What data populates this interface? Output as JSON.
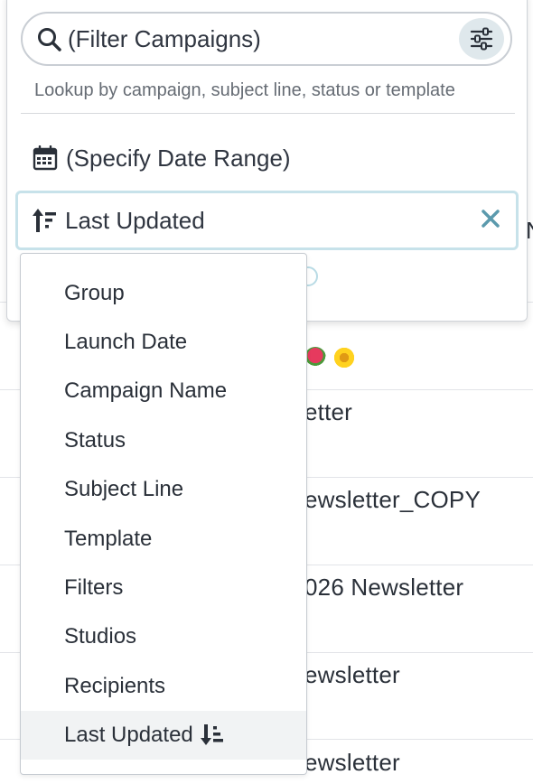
{
  "filter": {
    "search_placeholder": "(Filter Campaigns)",
    "hint": "Lookup by campaign, subject line, status or template",
    "date_range_label": "(Specify Date Range)",
    "sort_label": "Last Updated"
  },
  "sort_menu": {
    "items": [
      {
        "label": "Group"
      },
      {
        "label": "Launch Date"
      },
      {
        "label": "Campaign Name"
      },
      {
        "label": "Status"
      },
      {
        "label": "Subject Line"
      },
      {
        "label": "Template"
      },
      {
        "label": "Filters"
      },
      {
        "label": "Studios"
      },
      {
        "label": "Recipients"
      },
      {
        "label": "Last Updated",
        "active": true,
        "icon": "sort-descending-icon"
      }
    ]
  },
  "background_rows": [
    {
      "text": "etter"
    },
    {
      "text": "ewsletter_COPY"
    },
    {
      "text": "026 Newsletter"
    },
    {
      "text": "ewsletter"
    },
    {
      "text": "ewsletter"
    }
  ],
  "background_right_edge": "N",
  "colors": {
    "accent": "#5b9aad",
    "border_focus": "#c7e2ea",
    "text": "#2f3540",
    "hint": "#666c74",
    "menu_active_bg": "#f1f3f4"
  }
}
